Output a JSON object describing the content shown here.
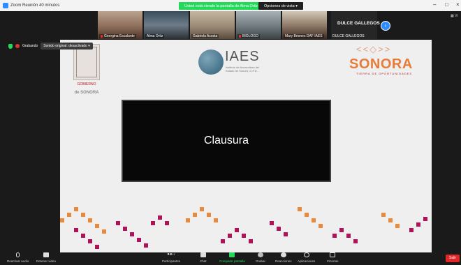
{
  "window": {
    "title": "Zoom Reunión 40 minutos",
    "sharing_banner": "Usted está viendo la pantalla de Alma Ortiz",
    "view_options_label": "Opciones de vista",
    "minimize": "–",
    "maximize": "□",
    "close": "×",
    "view_button": "Vi"
  },
  "participants": [
    {
      "name": "Georgina Escalante",
      "muted": true
    },
    {
      "name": "Alma Ortiz",
      "muted": false
    },
    {
      "name": "Gabriela Acosta",
      "muted": false
    },
    {
      "name": "BIOLOGO",
      "muted": true
    },
    {
      "name": "Mary Briones DAF IAES",
      "muted": false
    }
  ],
  "featured_participant": {
    "display_name": "DULCE GALLEGOS",
    "label": "DULCE GALLEGOS",
    "muted": true
  },
  "recording": {
    "status": "Grabando",
    "audio_label": "Sonido original: desactivado"
  },
  "slide": {
    "gov_label_top": "GOBIERNO",
    "gov_label_bottom": "de SONORA",
    "iaes_title": "IAES",
    "iaes_subtitle": "Instituto de Acuacultura del Estado de Sonora, O.P.D.",
    "sonora_ornament": "<<◇>>",
    "sonora_word": "SONORA",
    "sonora_subtitle": "TIERRA DE OPORTUNIDADES",
    "heading": "Clausura"
  },
  "toolbar": {
    "audio": "Reactivar audio",
    "video": "Detener video",
    "participants": "Participantes",
    "participants_count": "11",
    "chat": "Chat",
    "share": "Compartir pantalla",
    "record": "Grabar",
    "reactions": "Reacciones",
    "apps": "Aplicaciones",
    "whiteboards": "Pizarras",
    "leave": "Salir"
  },
  "colors": {
    "accent": "#2d8cff",
    "share_green": "#23d959",
    "record_red": "#e03434",
    "sonora_orange": "#e57c3a",
    "sonora_magenta": "#b5121b"
  }
}
